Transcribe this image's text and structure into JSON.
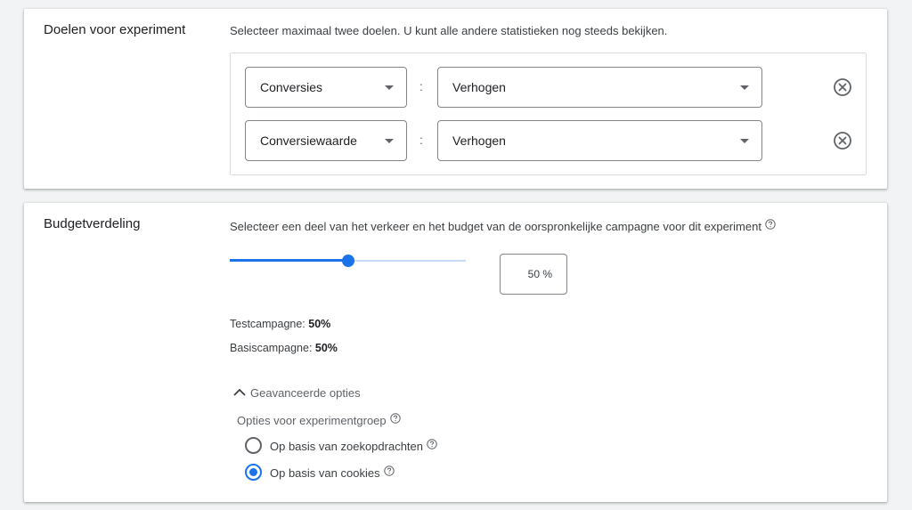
{
  "goals": {
    "title": "Doelen voor experiment",
    "description": "Selecteer maximaal twee doelen. U kunt alle andere statistieken nog steeds bekijken.",
    "rows": [
      {
        "metric": "Conversies",
        "separator": ":",
        "direction": "Verhogen",
        "remove_icon": "close-circle-icon"
      },
      {
        "metric": "Conversiewaarde",
        "separator": ":",
        "direction": "Verhogen",
        "remove_icon": "close-circle-icon"
      }
    ]
  },
  "budget": {
    "title": "Budgetverdeling",
    "description": "Selecteer een deel van het verkeer en het budget van de oorspronkelijke campagne voor dit experiment",
    "help_icon": "help-circle-icon",
    "slider_value": 0.5,
    "percentage_text": "50 %",
    "test_label": "Testcampagne: ",
    "test_value": "50%",
    "base_label": "Basiscampagne: ",
    "base_value": "50%",
    "advanced_label": "Geavanceerde opties",
    "advanced_icon": "chevron-up-icon",
    "group_options_label": "Opties voor experimentgroep",
    "options": [
      {
        "label": "Op basis van zoekopdrachten",
        "selected": false
      },
      {
        "label": "Op basis van cookies",
        "selected": true
      }
    ]
  },
  "colors": {
    "accent": "#1a73e8",
    "track_inactive": "#c6dafc",
    "background": "#f1f3f4"
  }
}
